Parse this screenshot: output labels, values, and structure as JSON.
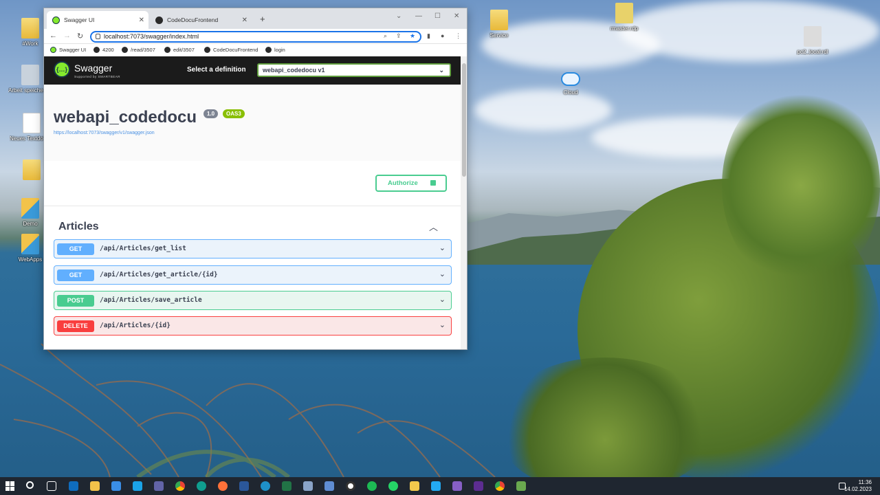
{
  "desktop": {
    "icons": [
      {
        "label": "#Work",
        "kind": "folder"
      },
      {
        "label": "Arbeit speichern (A) - Verknüpfung",
        "kind": "app"
      },
      {
        "label": "Neues Textdokument",
        "kind": "doc"
      },
      {
        "label": "",
        "kind": "folder"
      },
      {
        "label": "Demo",
        "kind": "app"
      },
      {
        "label": "WebApps",
        "kind": "app"
      },
      {
        "label": "Service",
        "kind": "folder"
      },
      {
        "label": "Cloud",
        "kind": "cloud"
      },
      {
        "label": "rmaster.rdp",
        "kind": "app"
      },
      {
        "label": "pc2_local.rdl",
        "kind": "app"
      }
    ]
  },
  "browser": {
    "tabs": [
      {
        "title": "Swagger UI"
      },
      {
        "title": "CodeDocuFrontend"
      }
    ],
    "new_tab_symbol": "+",
    "url": "localhost:7073/swagger/index.html",
    "bookmarks": [
      {
        "label": "Swagger UI"
      },
      {
        "label": "4200"
      },
      {
        "label": "/read/3507"
      },
      {
        "label": "edit/3507"
      },
      {
        "label": "CodeDocuFrontend"
      },
      {
        "label": "login"
      }
    ]
  },
  "swagger": {
    "brand": "Swagger",
    "brand_sub": "Supported by SMARTBEAR",
    "definition_label": "Select a definition",
    "definition_value": "webapi_codedocu v1",
    "api_title": "webapi_codedocu",
    "version_badge": "1.0",
    "oas_badge": "OAS3",
    "spec_url": "https://localhost:7073/swagger/v1/swagger.json",
    "authorize_label": "Authorize",
    "tag_name": "Articles",
    "operations": [
      {
        "method": "GET",
        "path": "/api/Articles/get_list"
      },
      {
        "method": "GET",
        "path": "/api/Articles/get_article/{id}"
      },
      {
        "method": "POST",
        "path": "/api/Articles/save_article"
      },
      {
        "method": "DELETE",
        "path": "/api/Articles/{id}"
      }
    ],
    "colors": {
      "get": "#61affe",
      "post": "#49cc90",
      "delete": "#f93e3e",
      "header_bg": "#1b1b1b",
      "swagger_green": "#85ea2d"
    }
  },
  "taskbar": {
    "time": "11:36",
    "date": "14.02.2023"
  }
}
